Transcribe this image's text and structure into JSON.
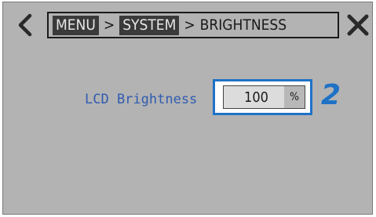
{
  "navigation": {
    "back_icon": "chevron-left-icon",
    "close_icon": "close-icon",
    "breadcrumb": {
      "items": [
        "MENU",
        "SYSTEM",
        "BRIGHTNESS"
      ],
      "separator": ">"
    }
  },
  "setting": {
    "label": "LCD Brightness",
    "value": "100",
    "unit": "%"
  },
  "annotation": {
    "step_number": "2",
    "highlight_color": "#1f72c6"
  },
  "colors": {
    "screen_background": "#b3b3b3",
    "label_text": "#2f5bb0",
    "breadcrumb_chip": "#3a3a3a"
  }
}
